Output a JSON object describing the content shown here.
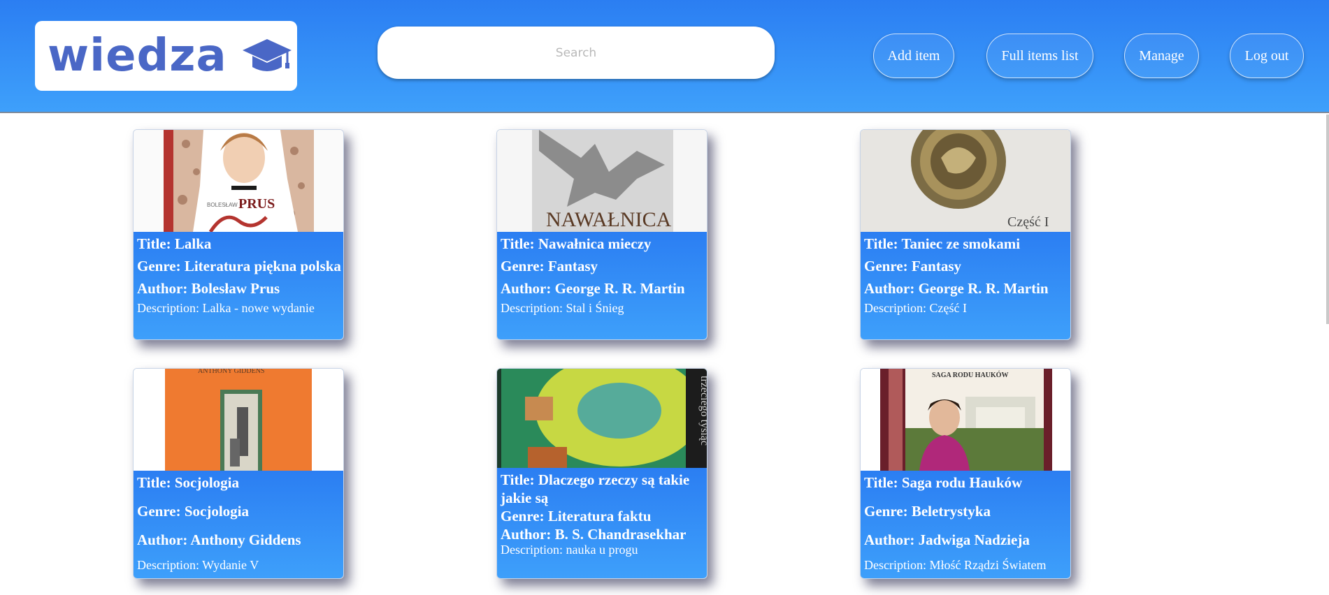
{
  "header": {
    "logo_text": "wiedza",
    "logo_icon": "graduation-cap-icon",
    "search_placeholder": "Search",
    "nav": [
      {
        "label": "Add item"
      },
      {
        "label": "Full items list"
      },
      {
        "label": "Manage"
      },
      {
        "label": "Log out"
      }
    ]
  },
  "colors": {
    "header_top": "#2b7ef2",
    "header_bottom": "#3ea0fb",
    "logo": "#4a67c6",
    "card_panel": "#2b7ef2"
  },
  "books": [
    {
      "title": "Title: Lalka",
      "genre": "Genre: Literatura piękna polska",
      "author": "Author: Bolesław Prus",
      "description": "Description: Lalka - nowe wydanie",
      "cover_text": "BOLESŁAW PRUS"
    },
    {
      "title": "Title: Nawałnica mieczy",
      "genre": "Genre: Fantasy",
      "author": "Author: George R. R. Martin",
      "description": "Description: Stal i Śnieg",
      "cover_text": "NAWAŁNICA"
    },
    {
      "title": "Title: Taniec ze smokami",
      "genre": "Genre: Fantasy",
      "author": "Author: George R. R. Martin",
      "description": "Description: Część I",
      "cover_text": "Część I"
    },
    {
      "title": "Title: Socjologia",
      "genre": "Genre: Socjologia",
      "author": "Author: Anthony Giddens",
      "description": "Description: Wydanie V",
      "cover_text": "ANTHONY GIDDENS"
    },
    {
      "title": "Title: Dlaczego rzeczy są takie jakie są",
      "genre": "Genre: Literatura faktu",
      "author": "Author: B. S. Chandrasekhar",
      "description": "Description: nauka u progu",
      "cover_text": "trzeciego tysiąc"
    },
    {
      "title": "Title: Saga rodu Hauków",
      "genre": "Genre: Beletrystyka",
      "author": "Author: Jadwiga Nadzieja",
      "description": "Description: Młość Rządzi Światem",
      "cover_text": "SAGA RODU HAUKÓW"
    }
  ]
}
